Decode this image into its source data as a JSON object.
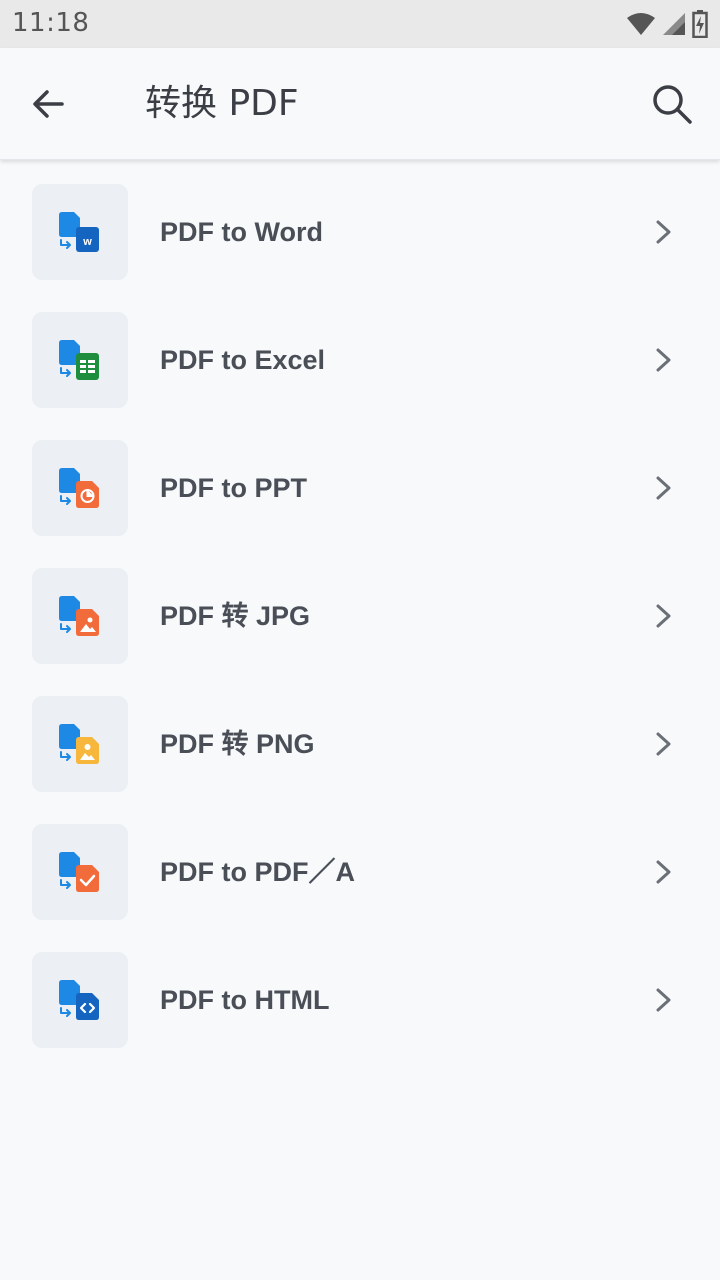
{
  "status_bar": {
    "time": "11:18",
    "icons": [
      "wifi-icon",
      "signal-icon",
      "battery-charging-icon"
    ]
  },
  "app_bar": {
    "back_icon": "arrow-left-icon",
    "title": "转换 PDF",
    "search_icon": "search-icon"
  },
  "items": [
    {
      "label": "PDF to Word",
      "icon": "pdf-to-word-icon",
      "accent": "#1565c0"
    },
    {
      "label": "PDF to Excel",
      "icon": "pdf-to-excel-icon",
      "accent": "#1e8e3e"
    },
    {
      "label": "PDF to PPT",
      "icon": "pdf-to-ppt-icon",
      "accent": "#f26b3a"
    },
    {
      "label": "PDF 转 JPG",
      "icon": "pdf-to-jpg-icon",
      "accent": "#f26b3a"
    },
    {
      "label": "PDF 转 PNG",
      "icon": "pdf-to-png-icon",
      "accent": "#f6b73c"
    },
    {
      "label": "PDF to PDF／A",
      "icon": "pdf-to-pdfa-icon",
      "accent": "#f26b3a"
    },
    {
      "label": "PDF to HTML",
      "icon": "pdf-to-html-icon",
      "accent": "#1565c0"
    }
  ],
  "colors": {
    "source_doc": "#1e88e5",
    "arrow": "#1e88e5",
    "chevron": "#6b7078"
  }
}
